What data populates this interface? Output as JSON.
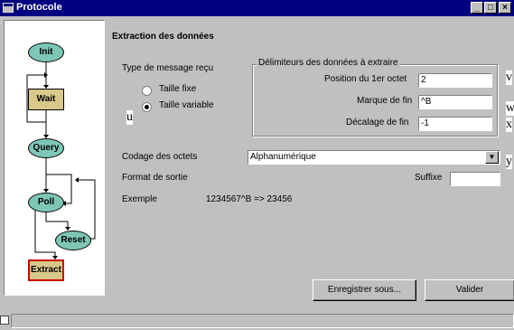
{
  "window": {
    "title": "Protocole",
    "minimize": "_",
    "maximize": "□",
    "close": "×"
  },
  "flow": {
    "nodes": {
      "init": "Init",
      "wait": "Wait",
      "query": "Query",
      "poll": "Poll",
      "reset": "Reset",
      "extract": "Extract"
    }
  },
  "form": {
    "heading": "Extraction des données",
    "message_type_label": "Type de message reçu",
    "radio_fixed": "Taille fixe",
    "radio_variable": "Taille variable",
    "delimiters_group": "Délimiteurs des données à extraire",
    "position_label": "Position du 1er octet",
    "position_value": "2",
    "end_marker_label": "Marque de fin",
    "end_marker_value": "^B",
    "end_offset_label": "Décalage de fin",
    "end_offset_value": "-1",
    "encoding_label": "Codage des octets",
    "encoding_value": "Alphanumérique",
    "output_format_label": "Format de sortie",
    "suffix_label": "Suffixe",
    "suffix_value": "",
    "example_label": "Exemple",
    "example_value": "1234567^B => 23456",
    "save_as_button": "Enregistrer sous...",
    "validate_button": "Valider"
  },
  "annotations": {
    "u": "u",
    "v": "v",
    "w": "w",
    "x": "x",
    "y": "y"
  }
}
